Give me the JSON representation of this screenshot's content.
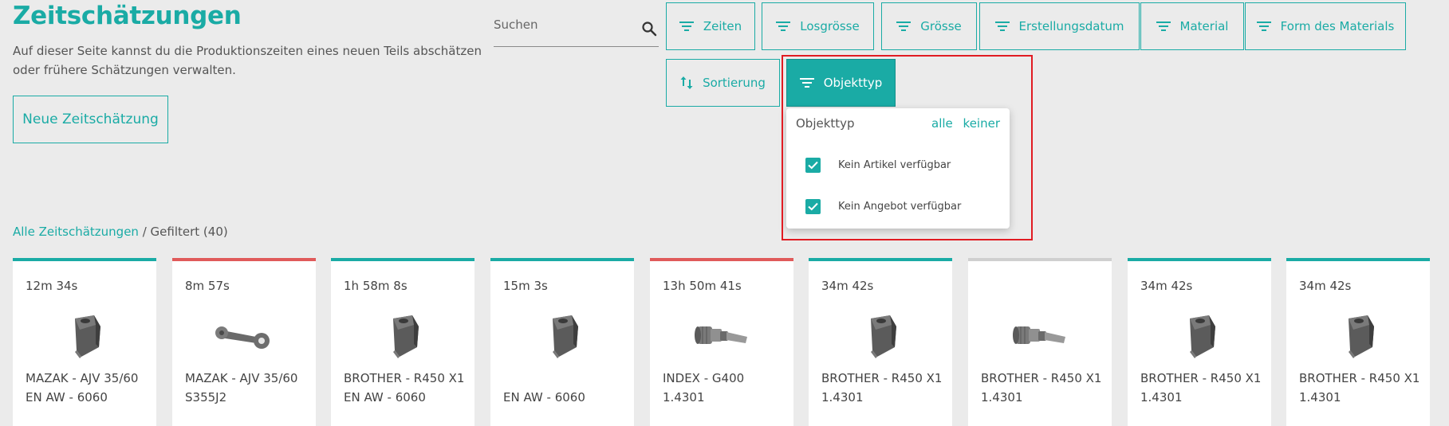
{
  "header": {
    "title": "Zeitschätzungen",
    "description": "Auf dieser Seite kannst du die Produktionszeiten eines neuen Teils abschätzen oder frühere Schätzungen verwalten.",
    "new_button": "Neue Zeitschätzung"
  },
  "search": {
    "placeholder": "Suchen"
  },
  "filters": {
    "zeiten": "Zeiten",
    "losgroesse": "Losgrösse",
    "groesse": "Grösse",
    "erstellungsdatum": "Erstellungsdatum",
    "material": "Material",
    "form": "Form des Materials",
    "sortierung": "Sortierung",
    "objekttyp": "Objekttyp"
  },
  "dropdown": {
    "title": "Objekttyp",
    "all": "alle",
    "none": "keiner",
    "items": [
      {
        "label": "Kein Artikel verfügbar",
        "checked": true
      },
      {
        "label": "Kein Angebot verfügbar",
        "checked": true
      }
    ]
  },
  "breadcrumb": {
    "root": "Alle Zeitschätzungen",
    "current": " / Gefiltert (40)"
  },
  "colors": {
    "accent": "#1aaba5",
    "red": "#e05a5a",
    "grey": "#cfcfcf",
    "highlight": "#e11b22"
  },
  "cards": [
    {
      "time": "12m 34s",
      "line1": "MAZAK - AJV 35/60",
      "line2": "EN AW - 6060",
      "status": "accent",
      "icon": "block-part-icon"
    },
    {
      "time": "8m 57s",
      "line1": "MAZAK - AJV 35/60",
      "line2": "S355J2",
      "status": "red",
      "icon": "lever-part-icon"
    },
    {
      "time": "1h 58m 8s",
      "line1": "BROTHER - R450 X1",
      "line2": "EN AW - 6060",
      "status": "accent",
      "icon": "block-part-icon"
    },
    {
      "time": "15m 3s",
      "line1": "",
      "line2": "EN AW - 6060",
      "status": "accent",
      "icon": "block-part-icon"
    },
    {
      "time": "13h 50m 41s",
      "line1": "INDEX - G400",
      "line2": "1.4301",
      "status": "red",
      "icon": "shaft-part-icon"
    },
    {
      "time": "34m 42s",
      "line1": "BROTHER - R450 X1",
      "line2": "1.4301",
      "status": "accent",
      "icon": "block-part-icon"
    },
    {
      "time": "",
      "line1": "BROTHER - R450 X1",
      "line2": "1.4301",
      "status": "grey",
      "icon": "shaft-part-icon"
    },
    {
      "time": "34m 42s",
      "line1": "BROTHER - R450 X1",
      "line2": "1.4301",
      "status": "accent",
      "icon": "block-part-icon"
    },
    {
      "time": "34m 42s",
      "line1": "BROTHER - R450 X1",
      "line2": "1.4301",
      "status": "accent",
      "icon": "block-part-icon"
    }
  ]
}
